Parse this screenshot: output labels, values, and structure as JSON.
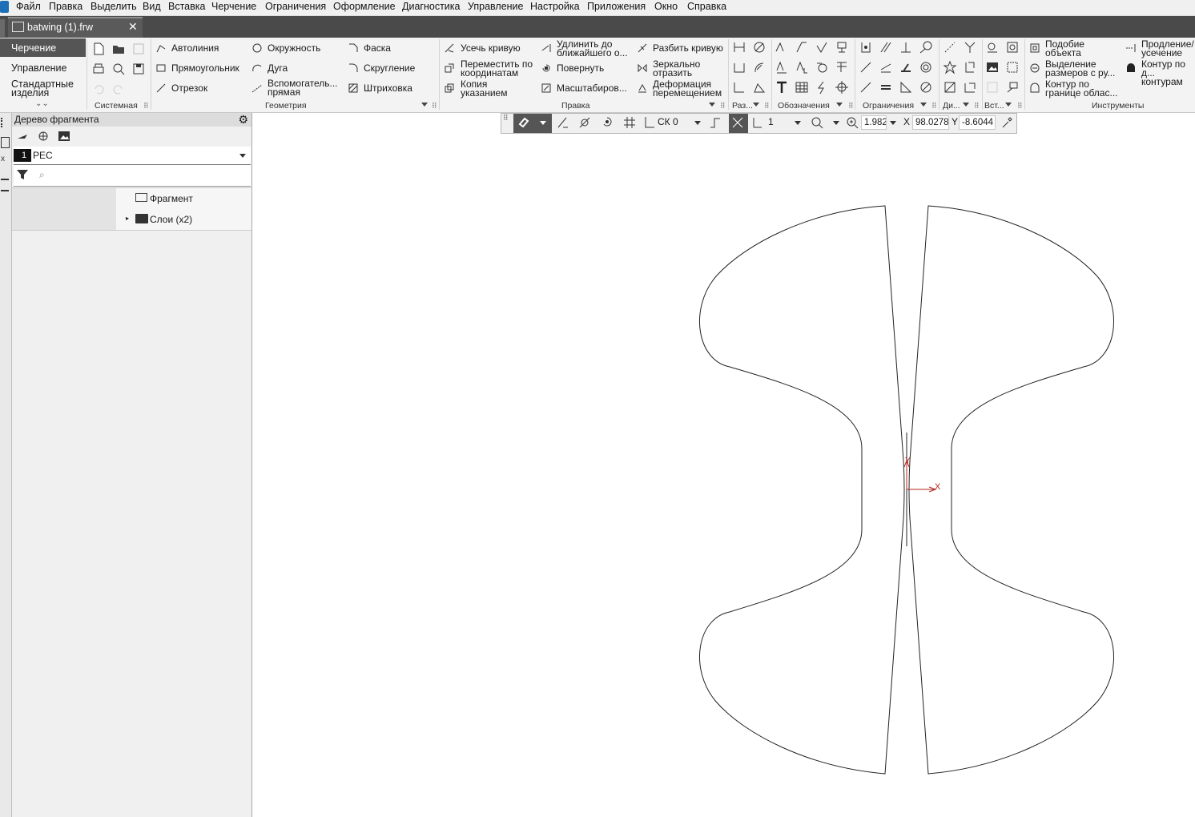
{
  "menu": [
    "Файл",
    "Правка",
    "Выделить",
    "Вид",
    "Вставка",
    "Черчение",
    "Ограничения",
    "Оформление",
    "Диагностика",
    "Управление",
    "Настройка",
    "Приложения",
    "Окно",
    "Справка"
  ],
  "tab": {
    "title": "batwing (1).frw",
    "close": "✕"
  },
  "modes": [
    "Черчение",
    "Управление",
    "Стандартные изделия"
  ],
  "ribbon": {
    "groups": [
      "Системная",
      "Геометрия",
      "Правка",
      "Раз...",
      "Обозначения",
      "Ограничения",
      "Ди...",
      "Вст...",
      "Инструменты"
    ],
    "geometry": [
      "Автолиния",
      "Окружность",
      "Фаска",
      "Прямоугольник",
      "Дуга",
      "Скругление",
      "Отрезок",
      "Вспомогатель... прямая",
      "Штриховка"
    ],
    "edit": [
      "Усечь кривую",
      "Удлинить до ближайшего о...",
      "Разбить кривую",
      "Переместить по координатам",
      "Повернуть",
      "Зеркально отразить",
      "Копия указанием",
      "Масштабиров...",
      "Деформация перемещением"
    ],
    "tools": [
      "Подобие объекта",
      "Продление/ усечение",
      "Выделение размеров с ру...",
      "Контур по д... контурам",
      "Контур по границе облас..."
    ]
  },
  "tree": {
    "title": "Дерево фрагмента",
    "layer_num": "1",
    "layer_name": "РЕС",
    "search_placeholder": "",
    "items": [
      "Фрагмент",
      "Слои (x2)"
    ]
  },
  "toolbar": {
    "cs": "СК 0",
    "step": "1",
    "zoom": "1.982",
    "x_label": "X",
    "x_value": "98.0278",
    "y_label": "Y",
    "y_value": "-8.6044"
  },
  "drawing": {
    "axis_x": "X",
    "axis_y": "Y",
    "stroke": "#222222",
    "axis_color": "#b3261e"
  }
}
